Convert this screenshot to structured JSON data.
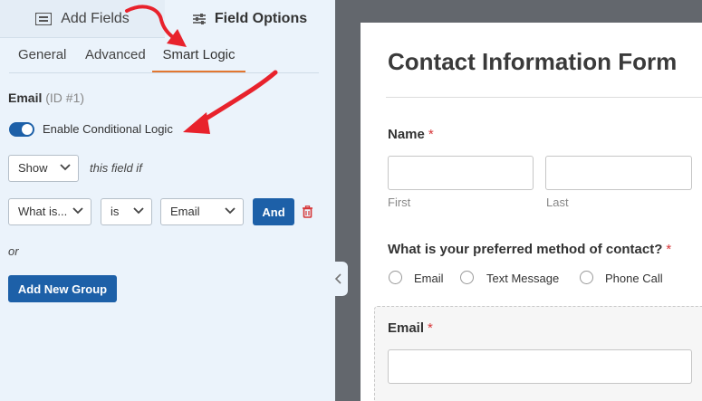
{
  "top_tabs": {
    "add_fields": "Add Fields",
    "field_options": "Field Options"
  },
  "sub_tabs": {
    "general": "General",
    "advanced": "Advanced",
    "smart_logic": "Smart Logic"
  },
  "field": {
    "name": "Email",
    "id": "(ID #1)"
  },
  "conditional": {
    "enabled": true,
    "toggle_label": "Enable Conditional Logic",
    "action_value": "Show",
    "action_suffix": "this field if",
    "rule": {
      "field": "What is...",
      "operator": "is",
      "value": "Email"
    },
    "and_label": "And",
    "or_label": "or",
    "add_group_label": "Add New Group"
  },
  "preview": {
    "form_title": "Contact Information Form",
    "required_mark": "*",
    "name_label": "Name",
    "first_label": "First",
    "last_label": "Last",
    "method_label": "What is your preferred method of contact?",
    "method_options": [
      "Email",
      "Text Message",
      "Phone Call"
    ],
    "email_label": "Email"
  },
  "colors": {
    "accent": "#e27730",
    "primary": "#1d60a8",
    "arrow": "#e8222c",
    "required": "#d63638"
  },
  "icons": [
    "list-icon",
    "sliders-icon",
    "chevron-down-icon",
    "trash-icon",
    "chevron-left-icon"
  ]
}
